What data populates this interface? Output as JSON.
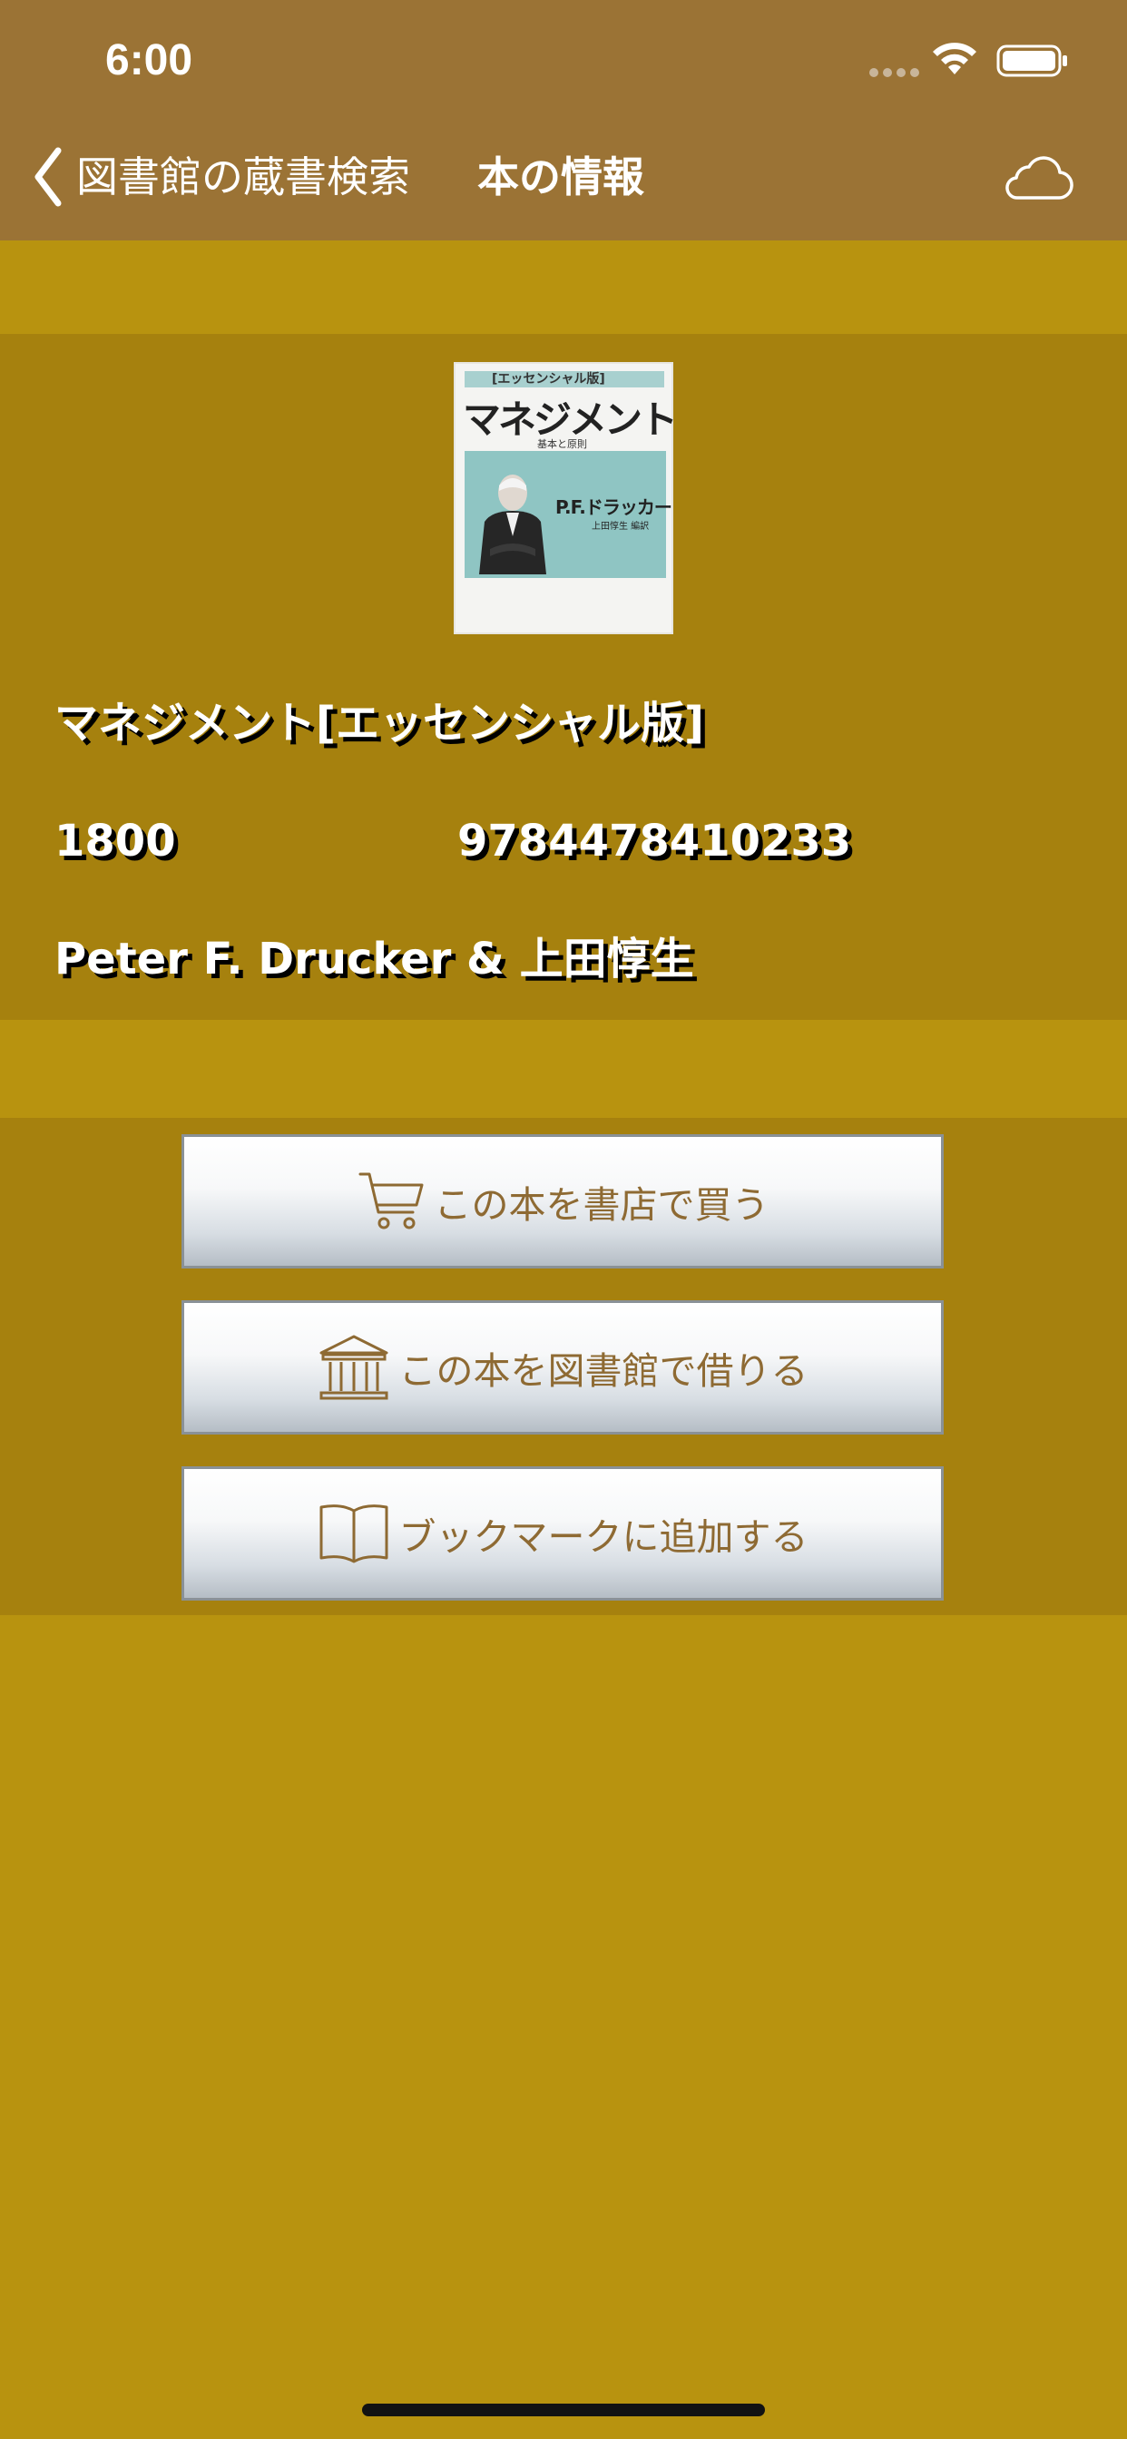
{
  "status_bar": {
    "time": "6:00"
  },
  "nav": {
    "back_label": "図書館の蔵書検索",
    "title": "本の情報"
  },
  "book": {
    "cover": {
      "banner": "[エッセンシャル版]",
      "title": "マネジメント",
      "subtitle": "基本と原則",
      "author": "P.F.ドラッカー",
      "translator": "上田惇生 編訳"
    },
    "title": "マネジメント[エッセンシャル版]",
    "price": "1800",
    "isbn": "9784478410233",
    "authors": "Peter F. Drucker & 上田惇生"
  },
  "actions": [
    {
      "label": "この本を書店で買う",
      "icon": "cart-icon"
    },
    {
      "label": "この本を図書館で借りる",
      "icon": "library-icon"
    },
    {
      "label": "ブックマークに追加する",
      "icon": "book-icon"
    }
  ],
  "colors": {
    "header": "#9b7335",
    "background": "#b8930f",
    "panel": "#a6810e",
    "button_text": "#8e6a33"
  }
}
